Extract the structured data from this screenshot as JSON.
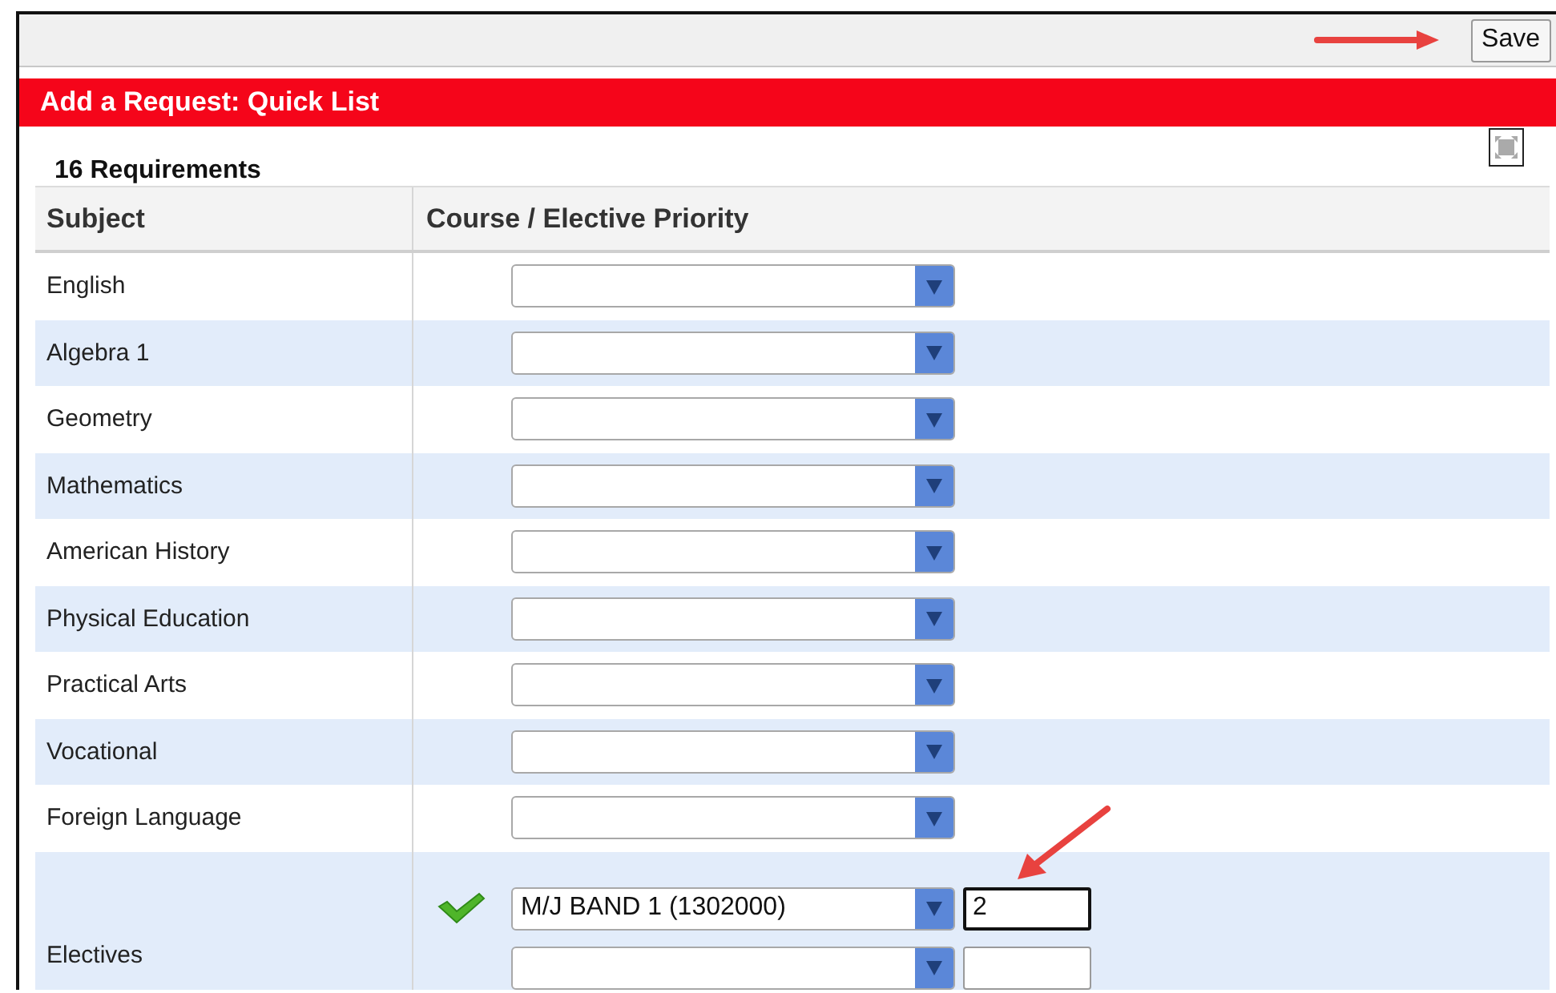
{
  "toolbar": {
    "save_button": "Save"
  },
  "panel": {
    "title": "Add a Request: Quick List",
    "count_label": "16 Requirements"
  },
  "table": {
    "columns": [
      "Subject",
      "Course / Elective Priority"
    ],
    "rows": [
      {
        "kind": "single",
        "subject": "English",
        "choices": [
          {
            "valid": false
          }
        ]
      },
      {
        "kind": "single",
        "subject": "Algebra 1",
        "choices": [
          {
            "valid": false
          }
        ]
      },
      {
        "kind": "single",
        "subject": "Geometry",
        "choices": [
          {
            "valid": false
          }
        ]
      },
      {
        "kind": "single",
        "subject": "Mathematics",
        "choices": [
          {
            "valid": false
          }
        ]
      },
      {
        "kind": "single",
        "subject": "American History",
        "choices": [
          {
            "valid": false
          }
        ]
      },
      {
        "kind": "single",
        "subject": "Physical Education",
        "choices": [
          {
            "valid": false
          }
        ]
      },
      {
        "kind": "single",
        "subject": "Practical Arts",
        "choices": [
          {
            "valid": false
          }
        ]
      },
      {
        "kind": "single",
        "subject": "Vocational",
        "choices": [
          {
            "valid": false
          }
        ]
      },
      {
        "kind": "single",
        "subject": "Foreign Language",
        "choices": [
          {
            "valid": false
          }
        ]
      },
      {
        "kind": "elective",
        "subject": "Electives",
        "choices": [
          {
            "value": "M/J BAND 1 (1302000)",
            "valid": true,
            "priority": "2",
            "focused": true
          },
          {
            "valid": false,
            "focused": false
          }
        ]
      }
    ]
  }
}
